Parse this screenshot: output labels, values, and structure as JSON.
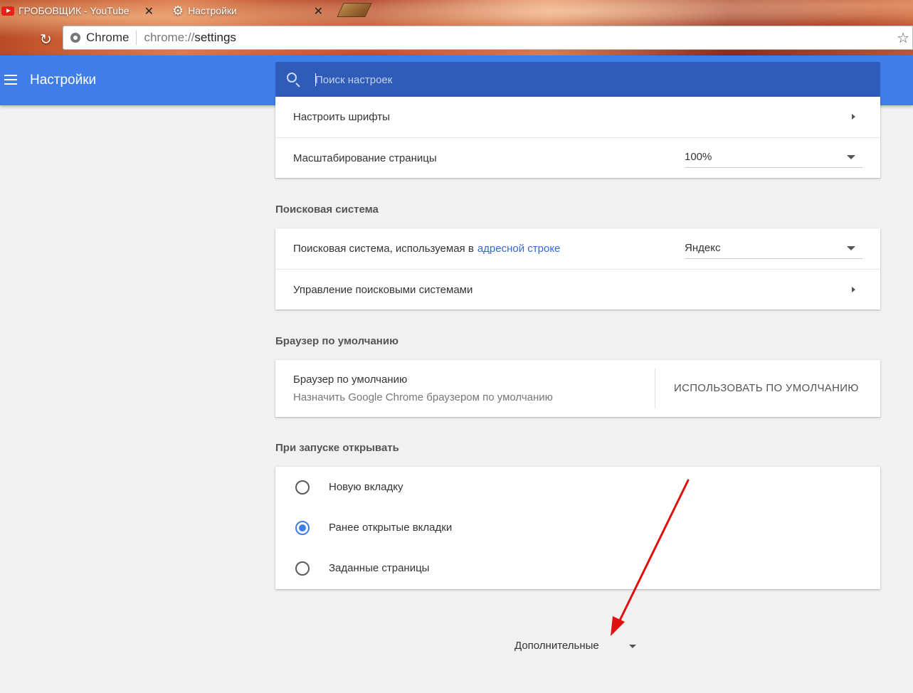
{
  "tabs": [
    {
      "title": "ГРОБОВЩИК - YouTube",
      "icon": "youtube-icon"
    },
    {
      "title": "Настройки",
      "icon": "gear-icon"
    }
  ],
  "omnibox": {
    "site": "Chrome",
    "scheme": "chrome://",
    "path": "settings"
  },
  "toolbar": {
    "title": "Настройки",
    "search_placeholder": "Поиск настроек"
  },
  "appearance": {
    "fonts_label": "Настроить шрифты",
    "zoom_label": "Масштабирование страницы",
    "zoom_value": "100%"
  },
  "search_engine": {
    "section_title": "Поисковая система",
    "engine_label": "Поисковая система, используемая в",
    "engine_link": "адресной строке",
    "engine_value": "Яндекс",
    "manage_label": "Управление поисковыми системами"
  },
  "default_browser": {
    "section_title": "Браузер по умолчанию",
    "title": "Браузер по умолчанию",
    "subtitle": "Назначить Google Chrome браузером по умолчанию",
    "button": "ИСПОЛЬЗОВАТЬ ПО УМОЛЧАНИЮ"
  },
  "on_startup": {
    "section_title": "При запуске открывать",
    "options": [
      {
        "label": "Новую вкладку",
        "checked": false
      },
      {
        "label": "Ранее открытые вкладки",
        "checked": true
      },
      {
        "label": "Заданные страницы",
        "checked": false
      }
    ]
  },
  "advanced_label": "Дополнительные",
  "colors": {
    "accent": "#3f7ee8",
    "search_bg": "#2f5cb8",
    "annotation_arrow": "#e01010"
  }
}
